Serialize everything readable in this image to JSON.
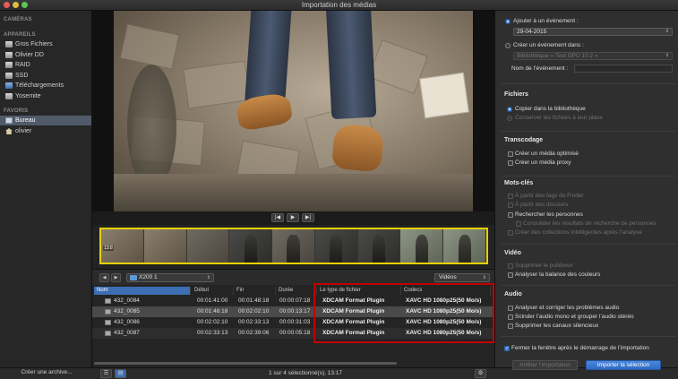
{
  "window": {
    "title": "Importation des médias"
  },
  "sidebar": {
    "cameras_header": "CAMÉRAS",
    "devices_header": "APPAREILS",
    "devices": [
      {
        "label": "Gros Fichiers",
        "icon": "disk-icon"
      },
      {
        "label": "Olivier DD",
        "icon": "disk-icon"
      },
      {
        "label": "RAID",
        "icon": "disk-icon"
      },
      {
        "label": "SSD",
        "icon": "disk-icon"
      },
      {
        "label": "Téléchargements",
        "icon": "disk-icon"
      },
      {
        "label": "Yosemite",
        "icon": "disk-icon"
      }
    ],
    "favorites_header": "FAVORIS",
    "favorites": [
      {
        "label": "Bureau",
        "icon": "desktop-icon",
        "selected": true
      },
      {
        "label": "olivier",
        "icon": "home-icon"
      }
    ],
    "create_archive_label": "Créer une archive..."
  },
  "filmstrip": {
    "timecode": "13:8"
  },
  "browser": {
    "folder": "X200 1",
    "filter": "Vidéos",
    "columns": [
      "Nom",
      "Début",
      "Fin",
      "Durée",
      "Le type de fichier",
      "Codecs"
    ],
    "rows": [
      {
        "name": "432_0084",
        "start": "00:01:41:00",
        "end": "00:01:48:18",
        "duration": "00:00:07:18",
        "type": "XDCAM Format Plugin",
        "codec": "XAVC HD 1080p25(50 Mo/s)"
      },
      {
        "name": "432_0085",
        "start": "00:01:48:18",
        "end": "00:02:02:10",
        "duration": "00:00:13:17",
        "type": "XDCAM Format Plugin",
        "codec": "XAVC HD 1080p25(50 Mo/s)",
        "selected": true
      },
      {
        "name": "432_0086",
        "start": "00:02:02:10",
        "end": "00:02:33:13",
        "duration": "00:00:31:03",
        "type": "XDCAM Format Plugin",
        "codec": "XAVC HD 1080p25(50 Mo/s)"
      },
      {
        "name": "432_0087",
        "start": "00:02:33:13",
        "end": "00:02:39:06",
        "duration": "00:00:05:18",
        "type": "XDCAM Format Plugin",
        "codec": "XAVC HD 1080p25(50 Mo/s)"
      }
    ],
    "status": "1 sur 4 sélectionné(s), 13:17"
  },
  "options": {
    "add_to_event_label": "Ajouter à un événement :",
    "event_value": "29-04-2015",
    "create_event_label": "Créer un événement dans :",
    "library_value": "Bibliothèque « Test GPU 10.2 »",
    "event_name_label": "Nom de l’événement :",
    "files_header": "Fichiers",
    "copy_to_library": "Copier dans la bibliothèque",
    "keep_in_place": "Conserver les fichiers à leur place",
    "transcode_header": "Transcodage",
    "create_optimized": "Créer un média optimisé",
    "create_proxy": "Créer un média proxy",
    "keywords_header": "Mots-clés",
    "from_finder_tags": "À partir des tags du Finder",
    "from_folders": "À partir des dossiers",
    "find_people": "Rechercher les personnes",
    "consolidate_people": "Consolider les résultats de recherche de personnes",
    "smart_collections": "Créer des collections intelligentes après l’analyse",
    "video_header": "Vidéo",
    "remove_pulldown": "Supprimer le pulldown",
    "analyze_color": "Analyser la balance des couleurs",
    "audio_header": "Audio",
    "fix_audio": "Analyser et corriger les problèmes audio",
    "split_mono": "Scinder l’audio mono et grouper l’audio stéréo",
    "remove_silent": "Supprimer les canaux silencieux",
    "close_window": "Fermer la fenêtre après le démarrage de l’importation",
    "stop_import": "Arrêter l’importation",
    "import_selection": "Importer la sélection"
  }
}
